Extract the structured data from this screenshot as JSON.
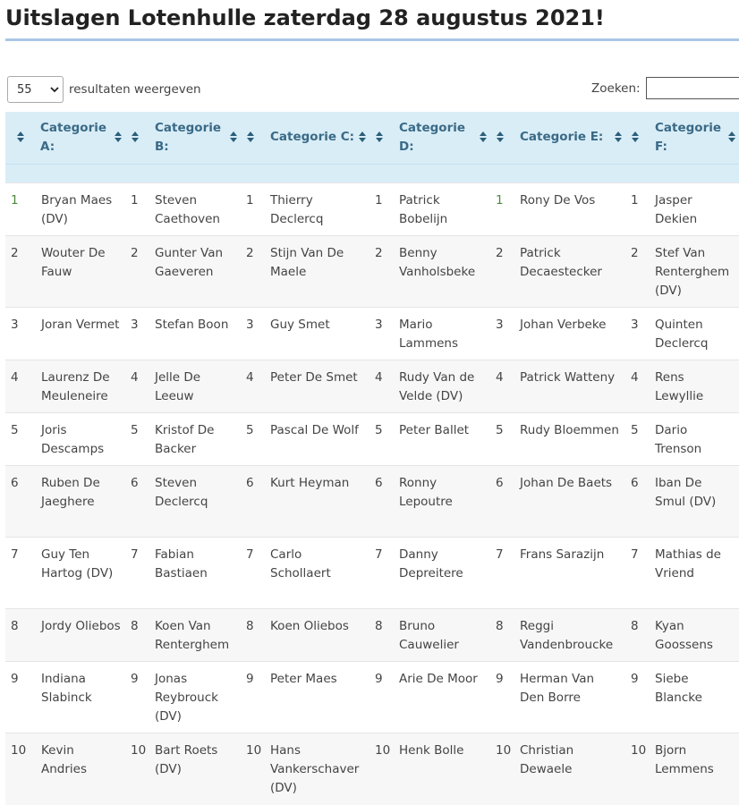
{
  "page": {
    "title": "Uitslagen Lotenhulle zaterdag 28 augustus 2021!"
  },
  "length_control": {
    "selected": "55",
    "label": "resultaten weergeven"
  },
  "search": {
    "label": "Zoeken:",
    "value": "",
    "placeholder": ""
  },
  "table": {
    "headers": [
      "Categorie A:",
      "Categorie B:",
      "Categorie C:",
      "Categorie D:",
      "Categorie E:",
      "Categorie F:"
    ],
    "rows": [
      {
        "n": [
          "1",
          "1",
          "1",
          "1",
          "1",
          "1"
        ],
        "names": [
          "Bryan Maes (DV)",
          "Steven Caethoven",
          "Thierry Declercq",
          "Patrick Bobelijn",
          "Rony De Vos",
          "Jasper Dekien"
        ]
      },
      {
        "n": [
          "2",
          "2",
          "2",
          "2",
          "2",
          "2"
        ],
        "names": [
          "Wouter De Fauw",
          "Gunter Van Gaeveren",
          "Stijn Van De Maele",
          "Benny Vanholsbeke",
          "Patrick Decaestecker",
          "Stef Van Renterghem (DV)"
        ]
      },
      {
        "n": [
          "3",
          "3",
          "3",
          "3",
          "3",
          "3"
        ],
        "names": [
          "Joran Vermet",
          "Stefan Boon",
          "Guy Smet",
          "Mario Lammens",
          "Johan Verbeke",
          "Quinten Declercq"
        ]
      },
      {
        "n": [
          "4",
          "4",
          "4",
          "4",
          "4",
          "4"
        ],
        "names": [
          "Laurenz De Meuleneire",
          "Jelle De Leeuw",
          "Peter De Smet",
          "Rudy Van de Velde (DV)",
          "Patrick Watteny",
          "Rens Lewyllie"
        ]
      },
      {
        "n": [
          "5",
          "5",
          "5",
          "5",
          "5",
          "5"
        ],
        "names": [
          "Joris Descamps",
          "Kristof De Backer",
          "Pascal De Wolf",
          "Peter Ballet",
          "Rudy Bloemmen",
          "Dario Trenson"
        ]
      },
      {
        "n": [
          "6",
          "6",
          "6",
          "6",
          "6",
          "6"
        ],
        "names": [
          "Ruben De Jaeghere",
          "Steven Declercq",
          "Kurt Heyman",
          "Ronny Lepoutre",
          "Johan De Baets",
          "Iban De Smul (DV)"
        ]
      },
      {
        "n": [
          "7",
          "7",
          "7",
          "7",
          "7",
          "7"
        ],
        "names": [
          "Guy Ten Hartog (DV)",
          "Fabian Bastiaen",
          "Carlo Schollaert",
          "Danny Depreitere",
          "Frans Sarazijn",
          "Mathias de Vriend"
        ]
      },
      {
        "n": [
          "8",
          "8",
          "8",
          "8",
          "8",
          "8"
        ],
        "names": [
          "Jordy Oliebos",
          "Koen Van Renterghem",
          "Koen Oliebos",
          "Bruno Cauwelier",
          "Reggi Vandenbroucke",
          "Kyan Goossens"
        ]
      },
      {
        "n": [
          "9",
          "9",
          "9",
          "9",
          "9",
          "9"
        ],
        "names": [
          "Indiana Slabinck",
          "Jonas Reybrouck (DV)",
          "Peter Maes",
          "Arie De Moor",
          "Herman Van Den Borre",
          "Siebe Blancke"
        ]
      },
      {
        "n": [
          "10",
          "10",
          "10",
          "10",
          "10",
          "10"
        ],
        "names": [
          "Kevin Andries",
          "Bart Roets (DV)",
          "Hans Vankerschaver (DV)",
          "Henk Bolle",
          "Christian Dewaele",
          "Bjorn Lemmens"
        ]
      }
    ]
  },
  "colors": {
    "header_bg": "#d9edf7",
    "header_text": "#3a6a86",
    "title_rule": "#a9c6e6",
    "rank_first_highlight": "#4a8a3c"
  },
  "icons": {
    "sort": "sort-both-icon",
    "select_arrow": "chevron-down-icon"
  }
}
